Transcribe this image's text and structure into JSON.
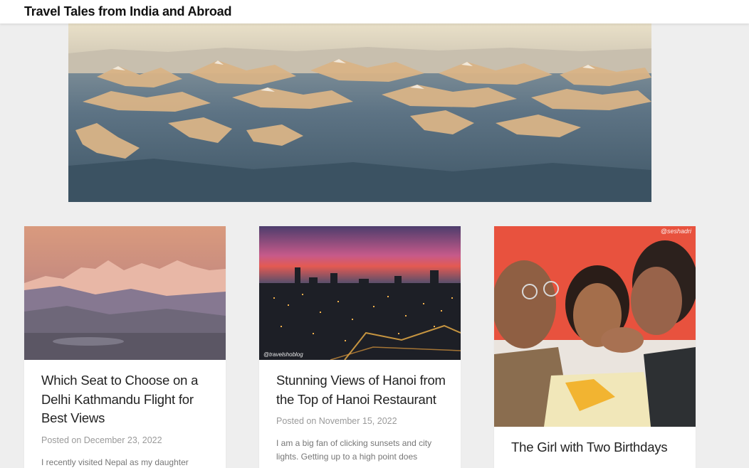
{
  "header": {
    "site_title": "Travel Tales from India and Abroad"
  },
  "hero": {
    "alt": "Aerial view of Himalayan mountain ranges"
  },
  "posts": [
    {
      "title": "Which Seat to Choose on a Delhi Kathmandu Flight for Best Views",
      "meta": "Posted on December 23, 2022",
      "excerpt": "I recently visited Nepal as my daughter"
    },
    {
      "title": "Stunning Views of Hanoi from the Top of Hanoi Restaurant",
      "meta": "Posted on November 15, 2022",
      "excerpt": "I am a big fan of clicking sunsets and city lights. Getting up to a high point does",
      "photo_credit": "@travelshoblog"
    },
    {
      "title": "The Girl with Two Birthdays",
      "watermark": "@seshadri"
    }
  ]
}
